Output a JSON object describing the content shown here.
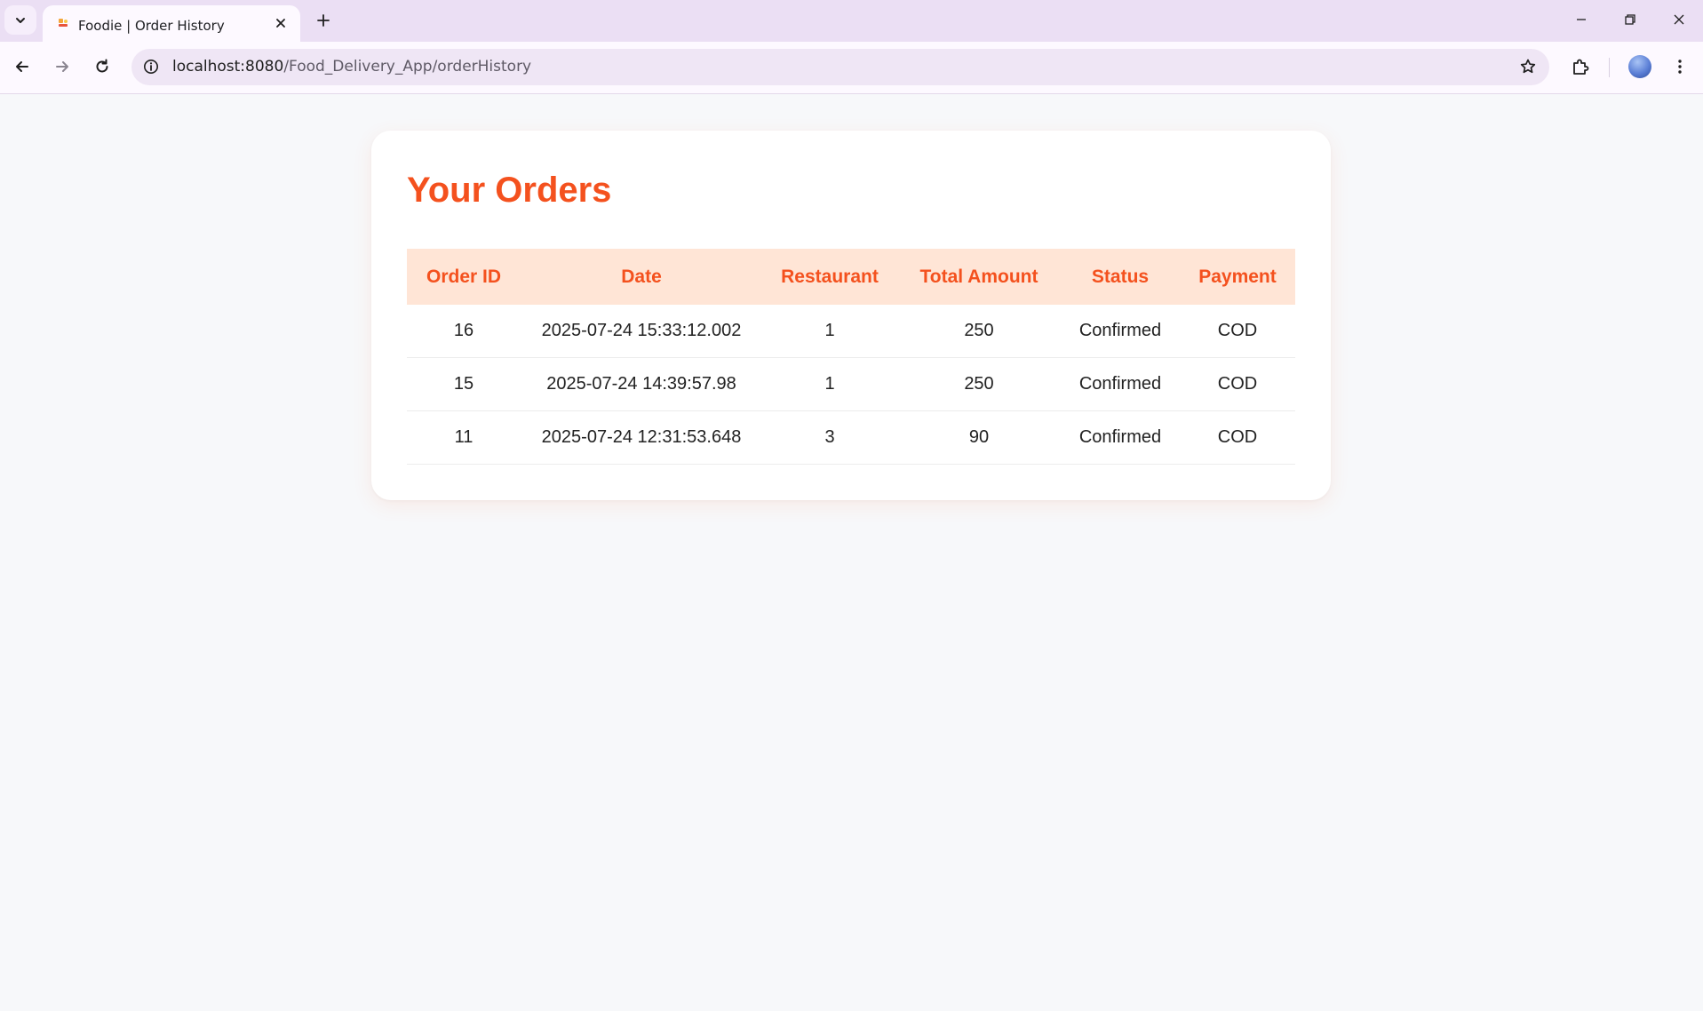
{
  "browser": {
    "tab_title": "Foodie | Order History",
    "url_host": "localhost:8080",
    "url_path": "/Food_Delivery_App/orderHistory"
  },
  "page": {
    "heading": "Your Orders",
    "accent_color": "#f4511e",
    "header_bg": "#ffe5d6"
  },
  "orders": {
    "columns": [
      "Order ID",
      "Date",
      "Restaurant",
      "Total Amount",
      "Status",
      "Payment"
    ],
    "rows": [
      [
        "16",
        "2025-07-24 15:33:12.002",
        "1",
        "250",
        "Confirmed",
        "COD"
      ],
      [
        "15",
        "2025-07-24 14:39:57.98",
        "1",
        "250",
        "Confirmed",
        "COD"
      ],
      [
        "11",
        "2025-07-24 12:31:53.648",
        "3",
        "90",
        "Confirmed",
        "COD"
      ]
    ]
  }
}
